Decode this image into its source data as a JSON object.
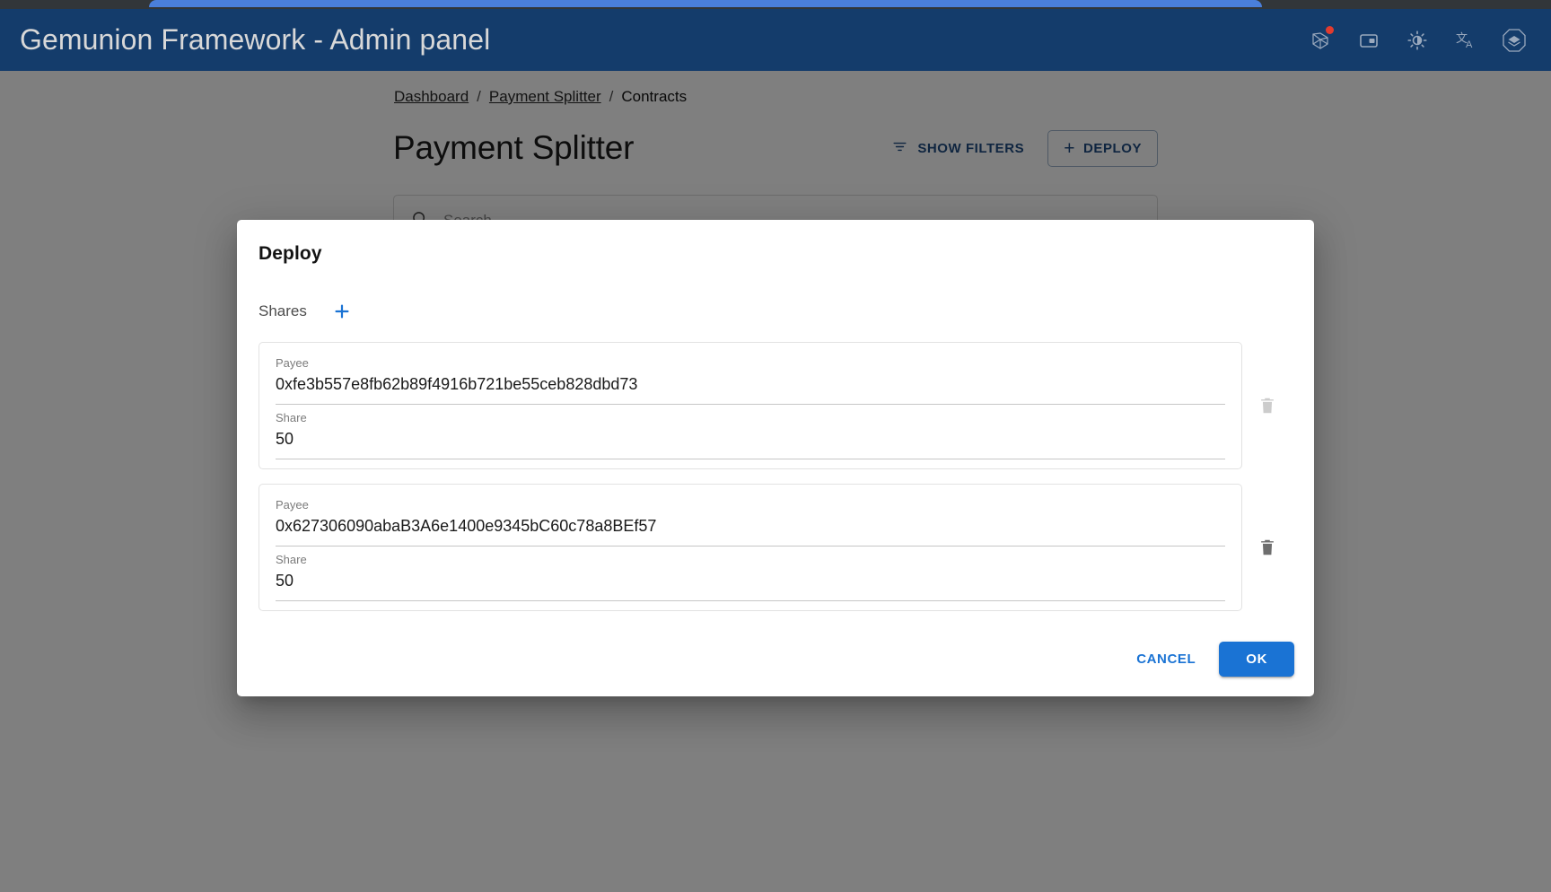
{
  "appbar": {
    "title": "Gemunion Framework - Admin panel",
    "background": "#143c6b",
    "icons": [
      {
        "name": "network-icon",
        "badge": true
      },
      {
        "name": "wallet-icon",
        "badge": false
      },
      {
        "name": "brightness-icon",
        "badge": false
      },
      {
        "name": "translate-icon",
        "badge": false
      },
      {
        "name": "logo-icon",
        "badge": false
      }
    ]
  },
  "breadcrumb": {
    "items": [
      {
        "label": "Dashboard",
        "link": true
      },
      {
        "label": "Payment Splitter",
        "link": true
      },
      {
        "label": "Contracts",
        "link": false
      }
    ],
    "separator": "/"
  },
  "page": {
    "title": "Payment Splitter",
    "show_filters_label": "SHOW FILTERS",
    "deploy_label": "DEPLOY",
    "deploy_plus": "+",
    "search_placeholder": "Search",
    "search_value": ""
  },
  "dialog": {
    "title": "Deploy",
    "shares_label": "Shares",
    "add_label": "+",
    "field_labels": {
      "payee": "Payee",
      "share": "Share"
    },
    "shares": [
      {
        "payee": "0xfe3b557e8fb62b89f4916b721be55ceb828dbd73",
        "share": "50",
        "delete_enabled": false
      },
      {
        "payee": "0x627306090abaB3A6e1400e9345bC60c78a8BEf57",
        "share": "50",
        "delete_enabled": true
      }
    ],
    "cancel_label": "CANCEL",
    "ok_label": "OK",
    "accent_color": "#1a73d4"
  }
}
